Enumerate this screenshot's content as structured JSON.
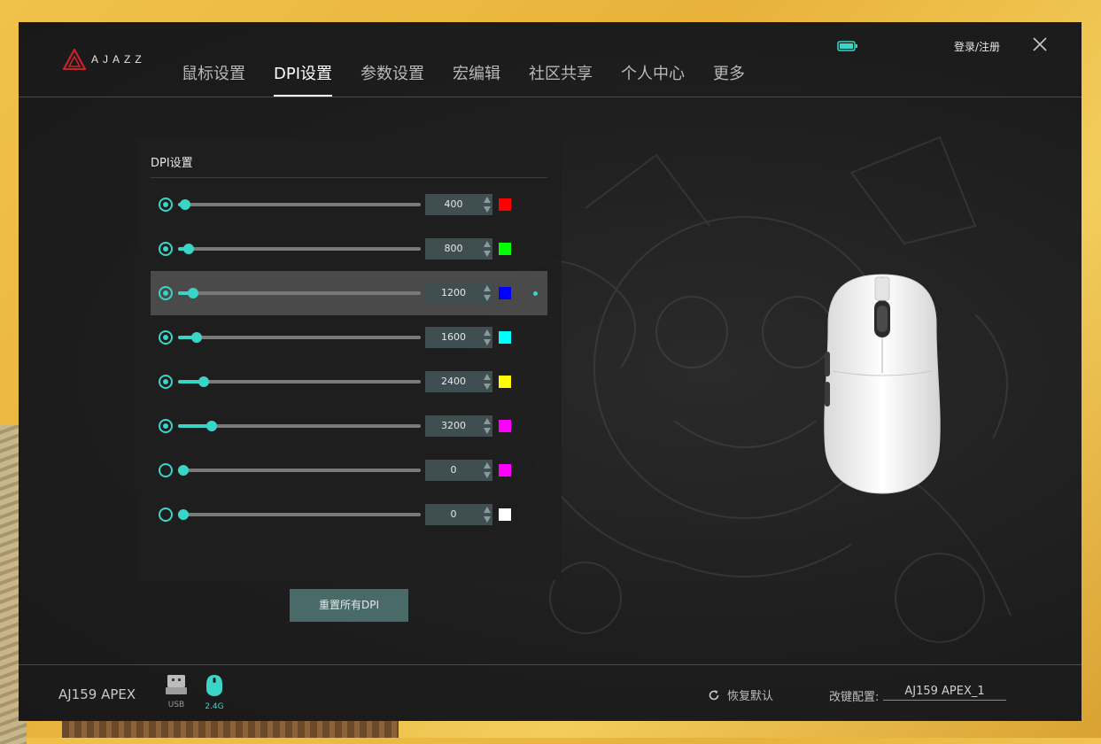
{
  "header": {
    "brand": "AJAZZ",
    "tabs": [
      {
        "label": "鼠标设置"
      },
      {
        "label": "DPI设置"
      },
      {
        "label": "参数设置"
      },
      {
        "label": "宏编辑"
      },
      {
        "label": "社区共享"
      },
      {
        "label": "个人中心"
      },
      {
        "label": "更多"
      }
    ],
    "active_tab": "DPI设置",
    "login": "登录/注册",
    "battery_icon": "battery-icon",
    "close_icon": "close-icon"
  },
  "dpi_panel": {
    "title": "DPI设置",
    "dpi_max": 26000,
    "rows": [
      {
        "value": "400",
        "dpi": 400,
        "color": "#ff0000",
        "enabled": true,
        "selected": false
      },
      {
        "value": "800",
        "dpi": 800,
        "color": "#00ff00",
        "enabled": true,
        "selected": false
      },
      {
        "value": "1200",
        "dpi": 1200,
        "color": "#0000ff",
        "enabled": true,
        "selected": true
      },
      {
        "value": "1600",
        "dpi": 1600,
        "color": "#00ffff",
        "enabled": true,
        "selected": false
      },
      {
        "value": "2400",
        "dpi": 2400,
        "color": "#ffff00",
        "enabled": true,
        "selected": false
      },
      {
        "value": "3200",
        "dpi": 3200,
        "color": "#ff00ff",
        "enabled": true,
        "selected": false
      },
      {
        "value": "0",
        "dpi": 0,
        "color": "#ff00ff",
        "enabled": false,
        "selected": false
      },
      {
        "value": "0",
        "dpi": 0,
        "color": "#ffffff",
        "enabled": false,
        "selected": false
      }
    ],
    "reset_label": "重置所有DPI"
  },
  "footer": {
    "device_name": "AJ159 APEX",
    "connections": [
      {
        "label": "USB",
        "icon": "usb-icon",
        "active": false
      },
      {
        "label": "2.4G",
        "icon": "wireless-mouse-icon",
        "active": true
      }
    ],
    "restore_label": "恢复默认",
    "key_config_label": "改键配置:",
    "key_config_value": "AJ159 APEX_1"
  },
  "colors": {
    "accent": "#39d6c8",
    "background": "#1d1d1d"
  }
}
